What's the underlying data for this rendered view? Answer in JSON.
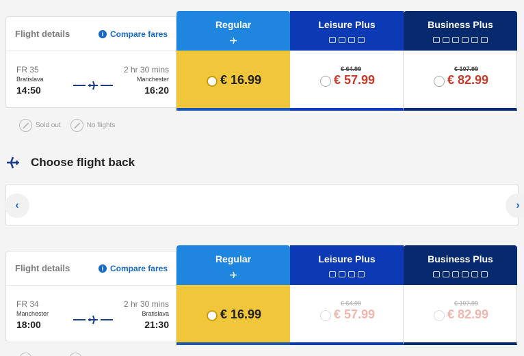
{
  "outbound": {
    "flight_details_label": "Flight details",
    "compare_fares_label": "Compare fares",
    "flight_number": "FR 35",
    "duration": "2 hr 30 mins",
    "origin": "Bratislava",
    "destination": "Manchester",
    "departure_time": "14:50",
    "arrival_time": "16:20",
    "fares": {
      "regular": {
        "name": "Regular",
        "price": "€ 16.99"
      },
      "leisure": {
        "name": "Leisure Plus",
        "old_price": "€ 64.99",
        "price": "€ 57.99"
      },
      "business": {
        "name": "Business Plus",
        "old_price": "€ 107.99",
        "price": "€ 82.99"
      }
    },
    "legend": {
      "sold_out": "Sold out",
      "no_flights": "No flights"
    }
  },
  "choose_back": {
    "title": "Choose flight back"
  },
  "date_strip": {
    "prev_icon": "chevron-left-icon",
    "next_icon": "chevron-right-icon"
  },
  "inbound": {
    "flight_details_label": "Flight details",
    "compare_fares_label": "Compare fares",
    "flight_number": "FR 34",
    "duration": "2 hr 30 mins",
    "origin": "Manchester",
    "destination": "Bratislava",
    "departure_time": "18:00",
    "arrival_time": "21:30",
    "fares": {
      "regular": {
        "name": "Regular",
        "price": "€ 16.99"
      },
      "leisure": {
        "name": "Leisure Plus",
        "old_price": "€ 64.99",
        "price": "€ 57.99"
      },
      "business": {
        "name": "Business Plus",
        "old_price": "€ 107.99",
        "price": "€ 82.99"
      }
    }
  },
  "colors": {
    "regular_header": "#1f86e0",
    "leisure_header": "#0c39b4",
    "business_header": "#07296e",
    "selected_fare": "#f0c63a",
    "price_red": "#c83a2a",
    "link_blue": "#1769c6"
  }
}
